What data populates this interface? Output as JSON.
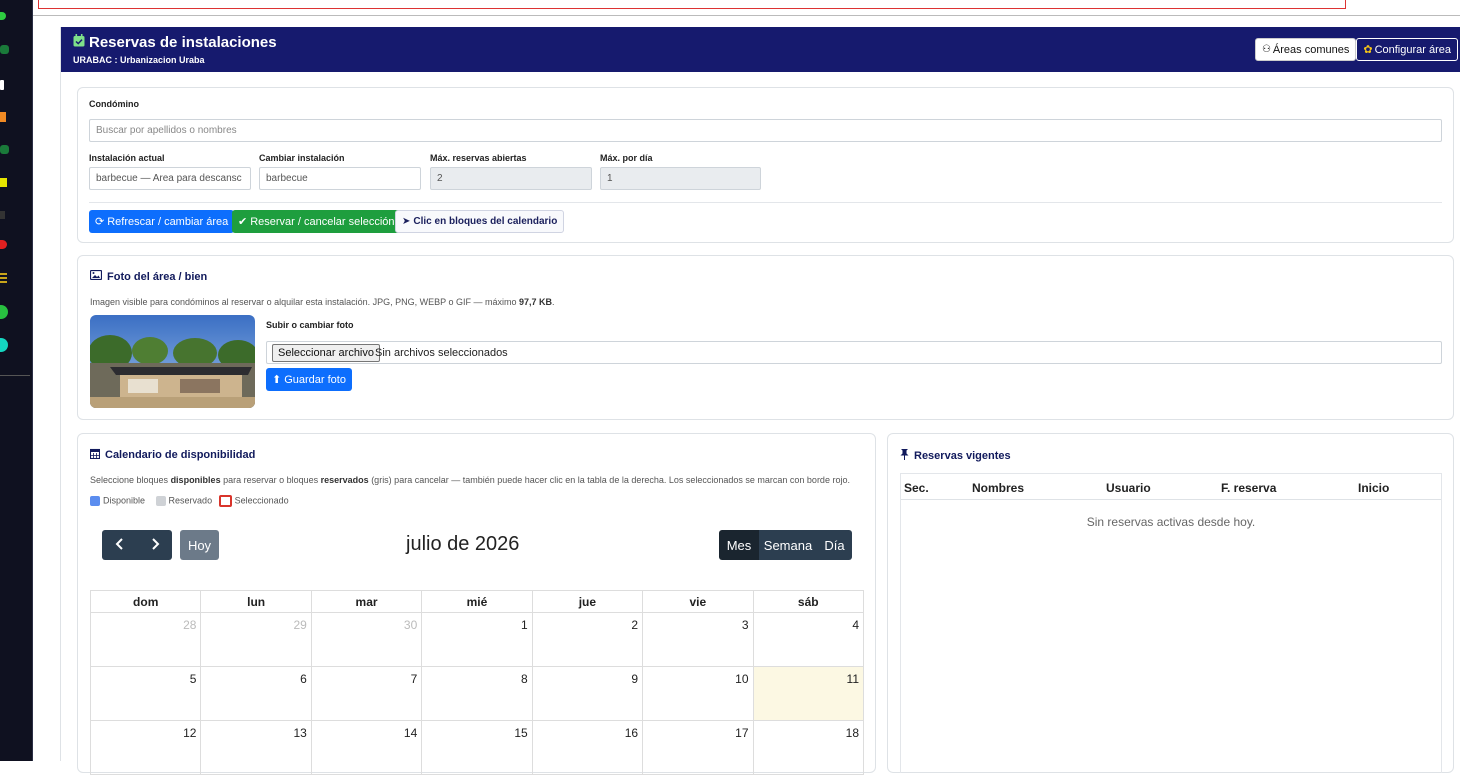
{
  "header": {
    "title": "Reservas de instalaciones",
    "subtitle": "URABAC : Urbanizacion Uraba",
    "btn_areas": "Áreas comunes",
    "btn_config": "Configurar área"
  },
  "form": {
    "condomino_label": "Condómino",
    "condomino_placeholder": "Buscar por apellidos o nombres",
    "instalacion_actual_label": "Instalación actual",
    "instalacion_actual_value": "barbecue — Area para descansc",
    "cambiar_instalacion_label": "Cambiar instalación",
    "cambiar_instalacion_value": "barbecue",
    "max_abiertas_label": "Máx. reservas abiertas",
    "max_abiertas_value": "2",
    "max_dia_label": "Máx. por día",
    "max_dia_value": "1",
    "btn_refrescar": "Refrescar / cambiar área",
    "btn_reservar": "Reservar / cancelar selección",
    "btn_clic": "Clic en bloques del calendario"
  },
  "foto": {
    "title": "Foto del área / bien",
    "help_prefix": "Imagen visible para condóminos al reservar o alquilar esta instalación. JPG, PNG, WEBP o GIF — máximo ",
    "help_max": "97,7 KB",
    "help_suffix": ".",
    "upload_label": "Subir o cambiar foto",
    "file_button": "Seleccionar archivo",
    "file_status": "Sin archivos seleccionados",
    "btn_guardar": "Guardar foto"
  },
  "calendar": {
    "title": "Calendario de disponibilidad",
    "help_1": "Seleccione bloques ",
    "help_b1": "disponibles",
    "help_2": " para reservar o bloques ",
    "help_b2": "reservados",
    "help_3": " (gris) para cancelar — también puede hacer clic en la tabla de la derecha. Los seleccionados se marcan con borde rojo.",
    "legend_disponible": "Disponible",
    "legend_reservado": "Reservado",
    "legend_seleccionado": "Seleccionado",
    "btn_hoy": "Hoy",
    "month_title": "julio de 2026",
    "view_mes": "Mes",
    "view_semana": "Semana",
    "view_dia": "Día",
    "weekdays": [
      "dom",
      "lun",
      "mar",
      "mié",
      "jue",
      "vie",
      "sáb"
    ],
    "weeks": [
      [
        "28",
        "29",
        "30",
        "1",
        "2",
        "3",
        "4"
      ],
      [
        "5",
        "6",
        "7",
        "8",
        "9",
        "10",
        "11"
      ],
      [
        "12",
        "13",
        "14",
        "15",
        "16",
        "17",
        "18"
      ]
    ]
  },
  "reservas": {
    "title": "Reservas vigentes",
    "col_sec": "Sec.",
    "col_nombres": "Nombres",
    "col_usuario": "Usuario",
    "col_freserva": "F. reserva",
    "col_inicio": "Inicio",
    "empty": "Sin reservas activas desde hoy."
  },
  "colors": {
    "header_bg": "#161a6e",
    "primary": "#0d6efd",
    "success": "#1e9e3e",
    "today": "#fcf8e3",
    "disponible": "#5b8def",
    "reservado": "#cfd2d6",
    "seleccionado": "#d9342b"
  }
}
